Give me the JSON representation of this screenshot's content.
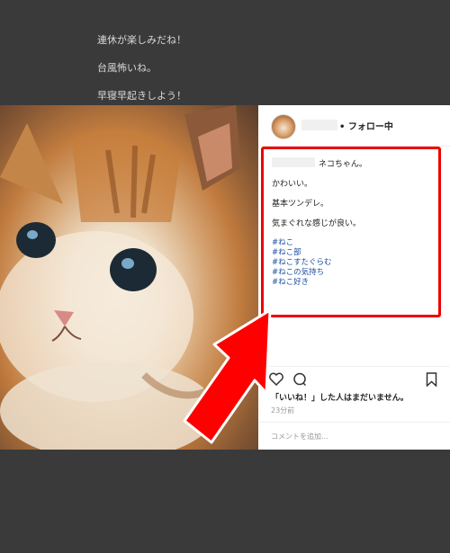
{
  "background_text": [
    "連休が楽しみだね！",
    "台風怖いね。",
    "早寝早起きしよう！"
  ],
  "post": {
    "follow_label": "• フォロー中",
    "caption_suffix": "ネコちゃん。",
    "caption_lines": [
      "かわいい。",
      "基本ツンデレ。",
      "気まぐれな感じが良い。"
    ],
    "hashtags": [
      "#ねこ",
      "#ねこ部",
      "#ねこすたぐらむ",
      "#ねこの気持ち",
      "#ねこ好き"
    ],
    "likes_text": "「いいね！」した人はまだいません。",
    "timestamp": "23分前",
    "add_comment_placeholder": "コメントを追加..."
  },
  "colors": {
    "highlight": "#e00000",
    "arrow": "#ff0000",
    "hashtag": "#1a4ea0"
  }
}
